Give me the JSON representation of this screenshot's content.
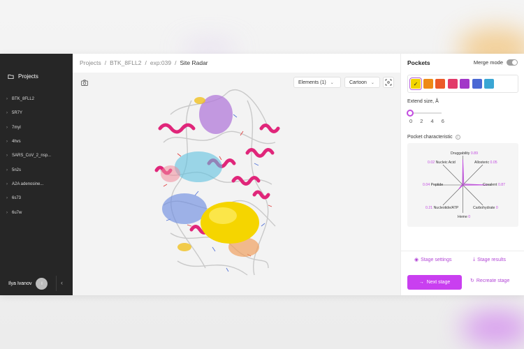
{
  "sidebar": {
    "title": "Projects",
    "items": [
      {
        "label": "BTK_8FLL2"
      },
      {
        "label": "5R7Y"
      },
      {
        "label": "7myl"
      },
      {
        "label": "4hvs"
      },
      {
        "label": "SARS_CoV_2_nsp..."
      },
      {
        "label": "5n2s"
      },
      {
        "label": "A2A adenosine..."
      },
      {
        "label": "6s73"
      },
      {
        "label": "6u7w"
      }
    ],
    "user_name": "Ilya Ivanov",
    "user_initial": "I"
  },
  "breadcrumb": [
    "Projects",
    "BTK_8FLL2",
    "exp:039",
    "Site Radar"
  ],
  "viewer": {
    "elements_dropdown": "Elements (1)",
    "style_dropdown": "Cartoon"
  },
  "panel": {
    "title": "Pockets",
    "merge_mode_label": "Merge mode",
    "merge_mode_on": false,
    "swatches": [
      "#f2d400",
      "#ee8a16",
      "#ec5a28",
      "#e23a6a",
      "#a237c8",
      "#4a68d4",
      "#3aa6d4"
    ],
    "selected_swatch": 0,
    "extend_label": "Extend size, Å",
    "extend_ticks": [
      "0",
      "2",
      "4",
      "6"
    ],
    "extend_value": 0,
    "characteristic_label": "Pocket characteristic",
    "radar": [
      {
        "name": "Druggability",
        "value": "0.89"
      },
      {
        "name": "Allosteric",
        "value": "0.05"
      },
      {
        "name": "Covalent",
        "value": "0.87"
      },
      {
        "name": "Carbohydrate",
        "value": "0"
      },
      {
        "name": "Heme",
        "value": "0"
      },
      {
        "name": "Nucleotide/ATP",
        "value": "0.21"
      },
      {
        "name": "Peptide",
        "value": "0.04"
      },
      {
        "name": "Nucleic Acid",
        "value": "0.02"
      }
    ],
    "stage_settings": "Stage settings",
    "stage_results": "Stage results",
    "next_stage": "Next stage",
    "recreate_stage": "Recreate stage"
  },
  "colors": {
    "accent": "#c93ff0",
    "sidebar_bg": "#262626"
  }
}
